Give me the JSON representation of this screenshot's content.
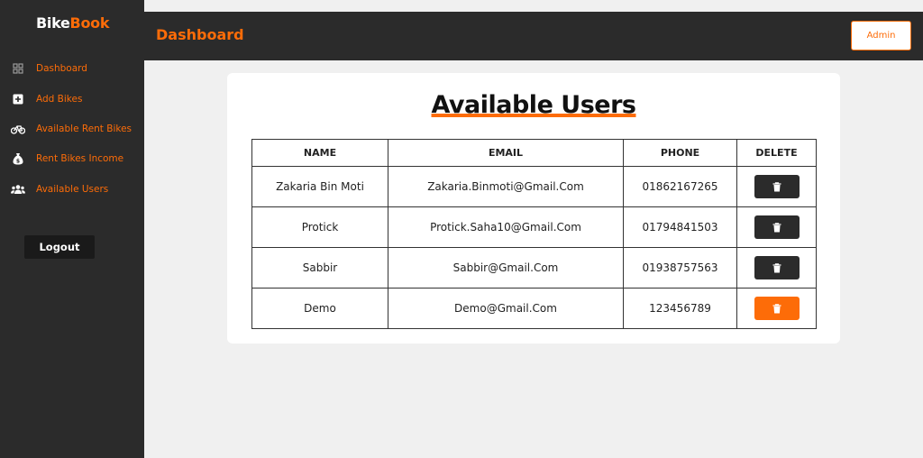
{
  "brand": {
    "part1": "Bike",
    "part2": "Book"
  },
  "sidebar": {
    "items": [
      {
        "label": "Dashboard",
        "icon": "dashboard-icon"
      },
      {
        "label": "Add Bikes",
        "icon": "plus-square-icon"
      },
      {
        "label": "Available Rent Bikes",
        "icon": "bicycle-icon"
      },
      {
        "label": "Rent Bikes Income",
        "icon": "money-bag-icon"
      },
      {
        "label": "Available Users",
        "icon": "users-icon"
      }
    ],
    "logout_label": "Logout"
  },
  "header": {
    "title": "Dashboard",
    "admin_label": "Admin"
  },
  "main": {
    "title": "Available Users",
    "columns": [
      "NAME",
      "EMAIL",
      "PHONE",
      "DELETE"
    ],
    "rows": [
      {
        "name": "Zakaria Bin Moti",
        "email": "Zakaria.Binmoti@Gmail.Com",
        "phone": "01862167265"
      },
      {
        "name": "Protick",
        "email": "Protick.Saha10@Gmail.Com",
        "phone": "01794841503"
      },
      {
        "name": "Sabbir",
        "email": "Sabbir@Gmail.Com",
        "phone": "01938757563"
      },
      {
        "name": "Demo",
        "email": "Demo@Gmail.Com",
        "phone": "123456789"
      }
    ]
  },
  "colors": {
    "accent": "#fd6c08",
    "dark": "#2b2b2b",
    "background": "#f0f0f0"
  }
}
